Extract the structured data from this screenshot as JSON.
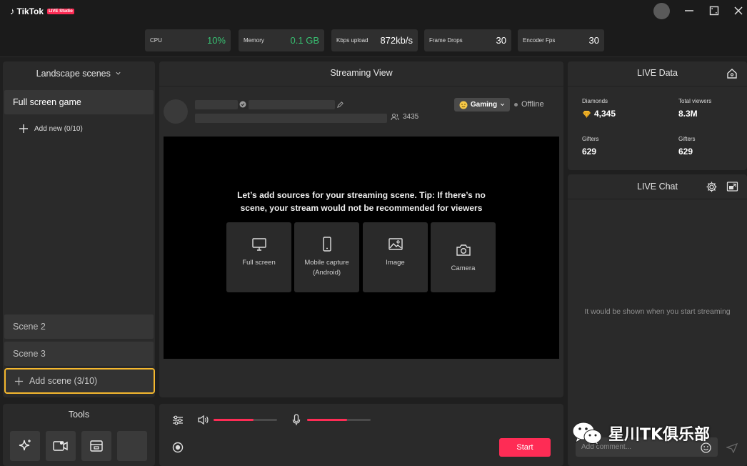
{
  "app": {
    "name": "TikTok",
    "badge": "LIVE Studio"
  },
  "stats": [
    {
      "label": "CPU",
      "value": "10%"
    },
    {
      "label": "Memory",
      "value": "0.1 GB"
    },
    {
      "label": "Kbps upload",
      "value": "872kb/s"
    },
    {
      "label": "Frame Drops",
      "value": "30"
    },
    {
      "label": "Encoder Fps",
      "value": "30"
    }
  ],
  "colors": {
    "accent": "#fe2c55",
    "highlight": "#f5b82e",
    "good": "#38c172"
  },
  "scenes": {
    "header": "Landscape scenes",
    "items": [
      "Full screen game",
      "Scene 2",
      "Scene 3"
    ],
    "add_new": "Add new (0/10)",
    "add_scene": "Add scene (3/10)"
  },
  "tools": {
    "title": "Tools",
    "icons": [
      "sparkle-icon",
      "camera-icon",
      "layout-icon",
      "empty-slot"
    ]
  },
  "streaming": {
    "title": "Streaming View",
    "viewer_count": "3435",
    "category": "Gaming",
    "status": "Offline",
    "tip": "Let’s add sources for your streaming scene. Tip: If there’s no scene, your stream would not be recommended for viewers",
    "sources": [
      {
        "label": "Full screen",
        "icon": "monitor-icon"
      },
      {
        "label": "Mobile capture (Android)",
        "icon": "phone-icon"
      },
      {
        "label": "Image",
        "icon": "image-icon"
      },
      {
        "label": "Camera",
        "icon": "camera-icon"
      }
    ]
  },
  "controls": {
    "speaker_level": 0.63,
    "mic_level": 0.63,
    "start_label": "Start"
  },
  "live_data": {
    "title": "LIVE Data",
    "metrics": [
      {
        "label": "Diamonds",
        "value": "4,345"
      },
      {
        "label": "Total viewers",
        "value": "8.3M"
      },
      {
        "label": "Gifters",
        "value": "629"
      },
      {
        "label": "Gifters",
        "value": "629"
      }
    ]
  },
  "chat": {
    "title": "LIVE Chat",
    "empty": "It would be shown when you start streaming",
    "placeholder": "Add comment..."
  },
  "watermark": {
    "text": "星川TK俱乐部"
  }
}
